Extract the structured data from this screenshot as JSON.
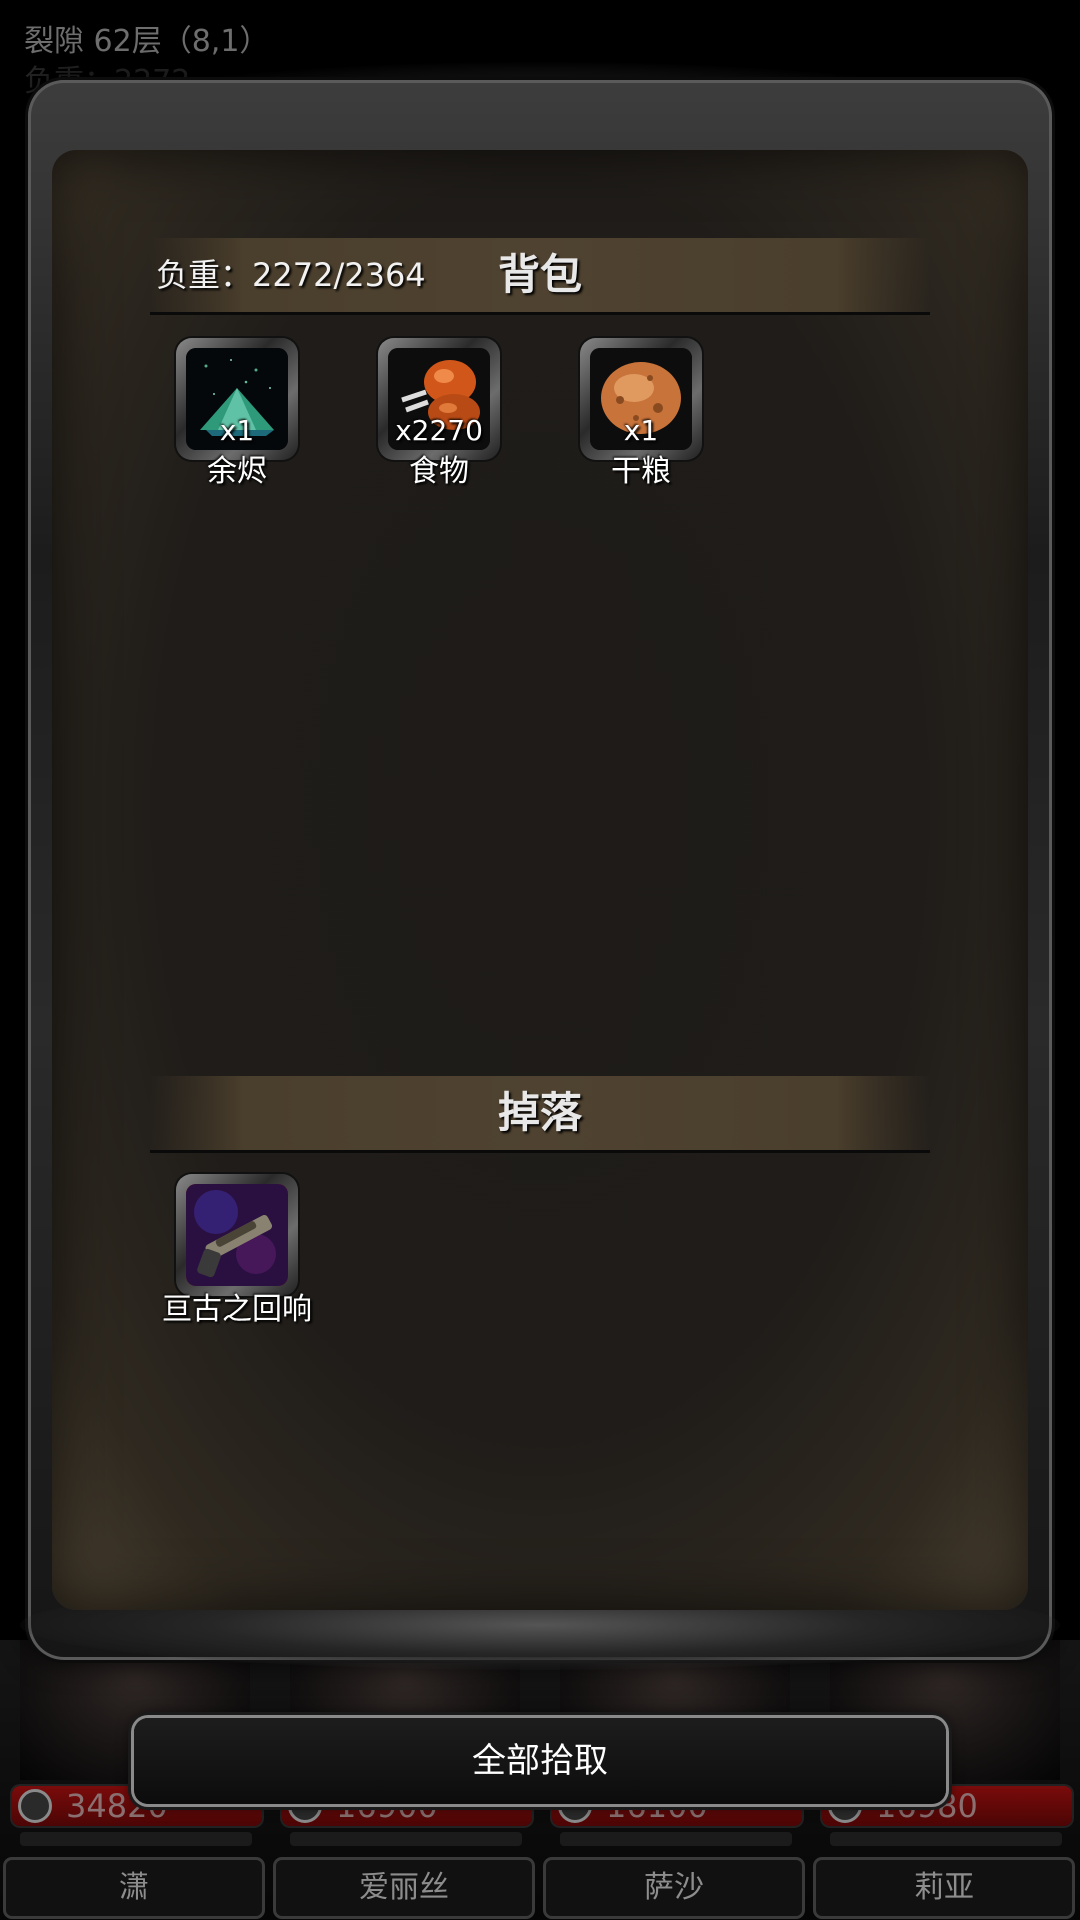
{
  "header": {
    "location": "裂隙 62层（8,1）",
    "sub": "负重：2272"
  },
  "backpack": {
    "title": "背包",
    "weight": "负重：2272/2364",
    "items": [
      {
        "name": "余烬",
        "count": "x1",
        "icon": "ember-crystal-icon"
      },
      {
        "name": "食物",
        "count": "x2270",
        "icon": "meat-drumstick-icon"
      },
      {
        "name": "干粮",
        "count": "x1",
        "icon": "bread-ration-icon"
      }
    ]
  },
  "drops": {
    "title": "掉落",
    "items": [
      {
        "name": "亘古之回响",
        "icon": "shotgun-weapon-icon",
        "rarity_color": "#c0281c"
      }
    ]
  },
  "pickup_all": "全部拾取",
  "party": [
    {
      "name": "潇",
      "hp": "34820"
    },
    {
      "name": "爱丽丝",
      "hp": "16900"
    },
    {
      "name": "萨沙",
      "hp": "16100"
    },
    {
      "name": "莉亚",
      "hp": "16980"
    }
  ]
}
